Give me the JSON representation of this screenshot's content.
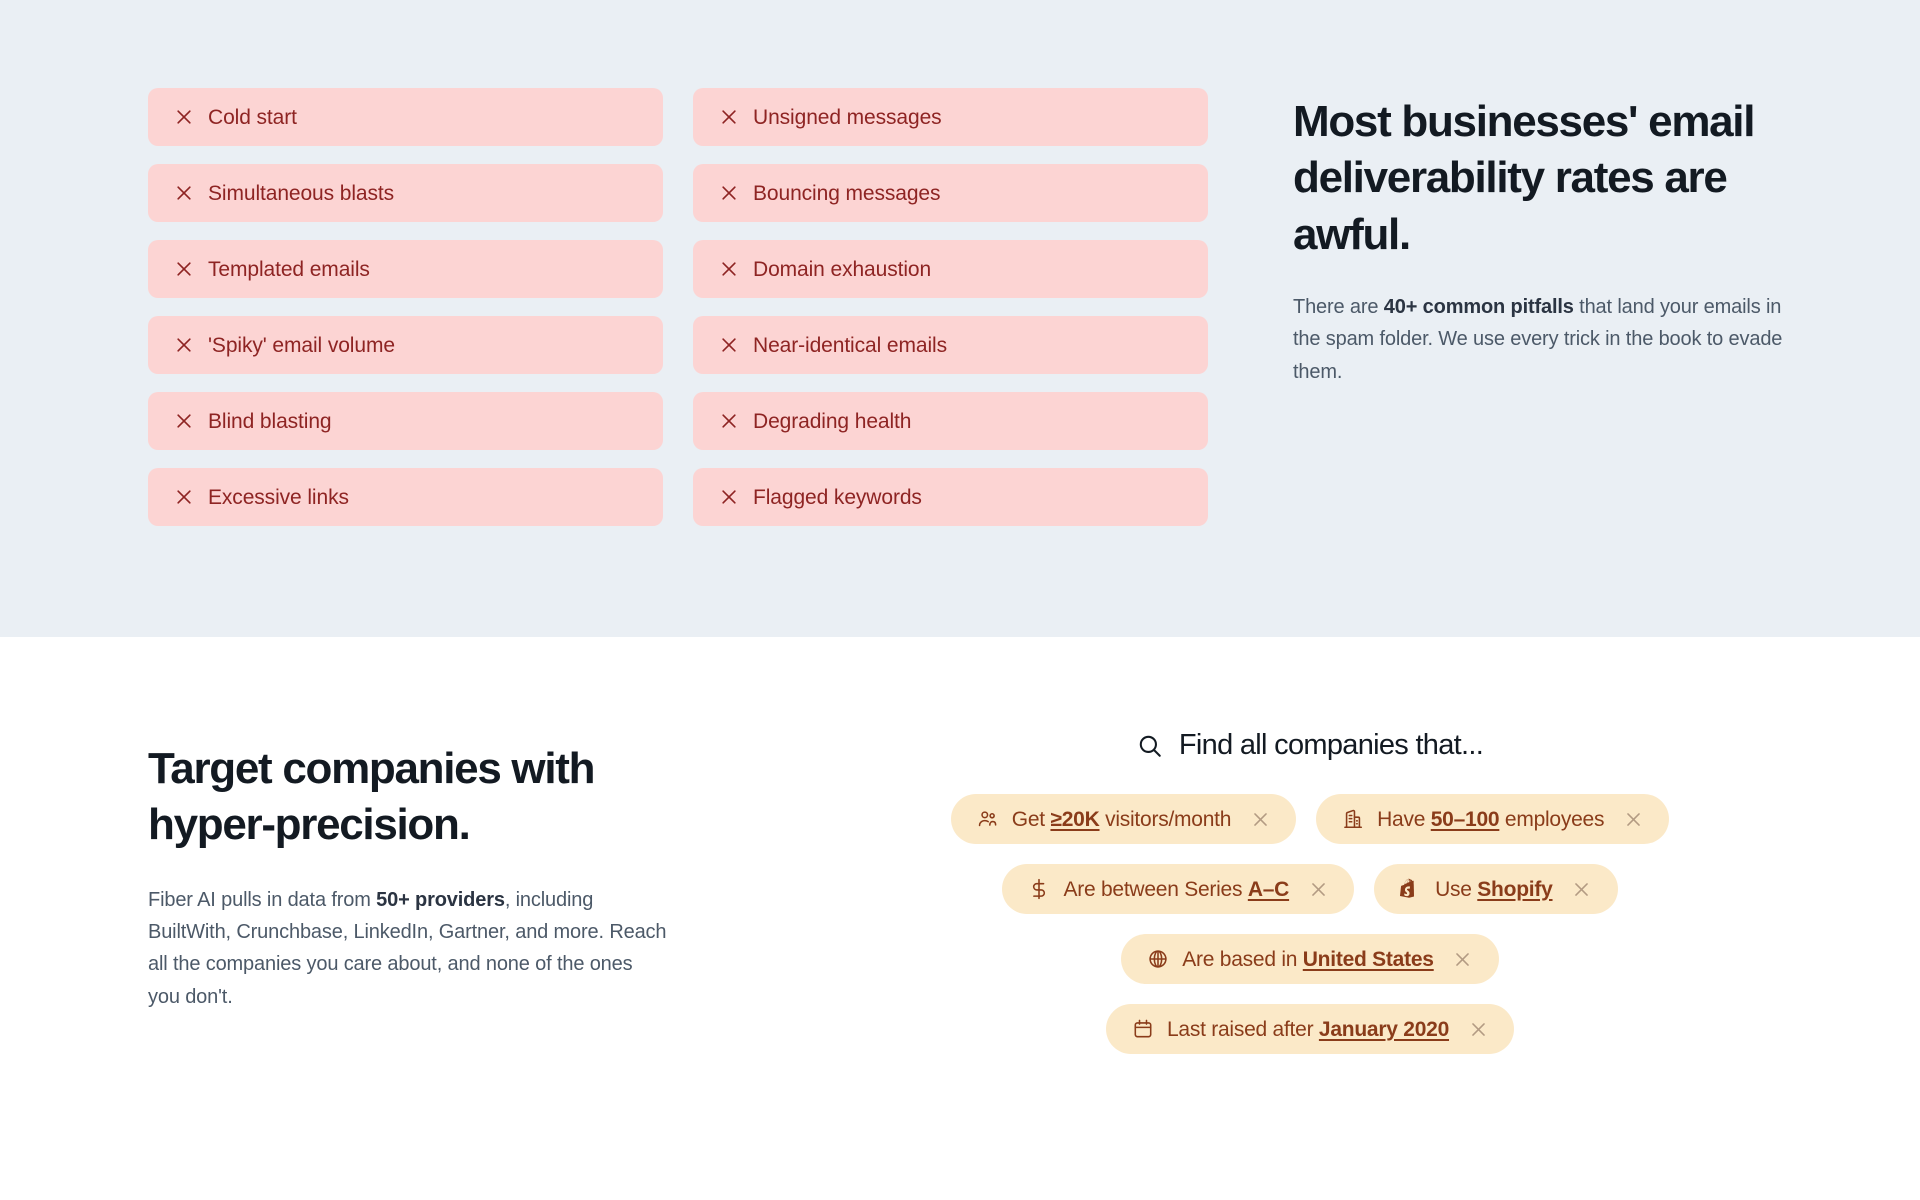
{
  "pitfalls": {
    "column_left": [
      {
        "icon": "close-icon",
        "label": "Cold start"
      },
      {
        "icon": "close-icon",
        "label": "Simultaneous blasts"
      },
      {
        "icon": "close-icon",
        "label": "Templated emails"
      },
      {
        "icon": "close-icon",
        "label": "'Spiky' email volume"
      },
      {
        "icon": "close-icon",
        "label": "Blind blasting"
      },
      {
        "icon": "close-icon",
        "label": "Excessive links"
      }
    ],
    "column_right": [
      {
        "icon": "close-icon",
        "label": "Unsigned messages"
      },
      {
        "icon": "close-icon",
        "label": "Bouncing messages"
      },
      {
        "icon": "close-icon",
        "label": "Domain exhaustion"
      },
      {
        "icon": "close-icon",
        "label": "Near-identical emails"
      },
      {
        "icon": "close-icon",
        "label": "Degrading health"
      },
      {
        "icon": "close-icon",
        "label": "Flagged keywords"
      }
    ],
    "heading": "Most businesses' email deliverability rates are awful.",
    "body": {
      "before": "There are ",
      "emphasis": "40+ common pitfalls",
      "after": " that land your emails in the spam folder. We use every trick in the book to evade them."
    },
    "colors": {
      "section_background": "#eaeff4",
      "card_background": "#fcd4d3",
      "card_text": "#8e2423",
      "heading_text": "#131a22",
      "body_text": "#4c5968"
    }
  },
  "targeting": {
    "heading": "Target companies with hyper-precision.",
    "body": {
      "before": "Fiber AI pulls in data from ",
      "emphasis": "50+ providers",
      "after": ", including BuiltWith, Crunchbase, LinkedIn, Gartner, and more. Reach all the companies you care about, and none of the ones you don't."
    },
    "search": {
      "icon": "search-icon",
      "label": "Find all companies that..."
    },
    "filter_rows": [
      [
        {
          "icon": "users-icon",
          "prefix": "Get ",
          "value": "≥20K",
          "suffix": " visitors/month",
          "close_icon": "close-icon"
        },
        {
          "icon": "building-icon",
          "prefix": "Have ",
          "value": "50–100",
          "suffix": " employees",
          "close_icon": "close-icon"
        }
      ],
      [
        {
          "icon": "dollar-icon",
          "prefix": "Are between Series ",
          "value": "A–C",
          "suffix": "",
          "close_icon": "close-icon"
        },
        {
          "icon": "shopify-bag-icon",
          "prefix": "Use ",
          "value": "Shopify",
          "suffix": "",
          "close_icon": "close-icon"
        }
      ],
      [
        {
          "icon": "globe-icon",
          "prefix": "Are based in ",
          "value": "United States",
          "suffix": "",
          "close_icon": "close-icon"
        }
      ],
      [
        {
          "icon": "calendar-icon",
          "prefix": "Last raised after ",
          "value": "January 2020",
          "suffix": "",
          "close_icon": "close-icon"
        }
      ]
    ],
    "colors": {
      "section_background": "#ffffff",
      "pill_background": "#fbe9c8",
      "pill_text": "#8a3c1a",
      "pill_close": "#b39b83",
      "heading_text": "#131a22",
      "body_text": "#4c5968"
    }
  }
}
